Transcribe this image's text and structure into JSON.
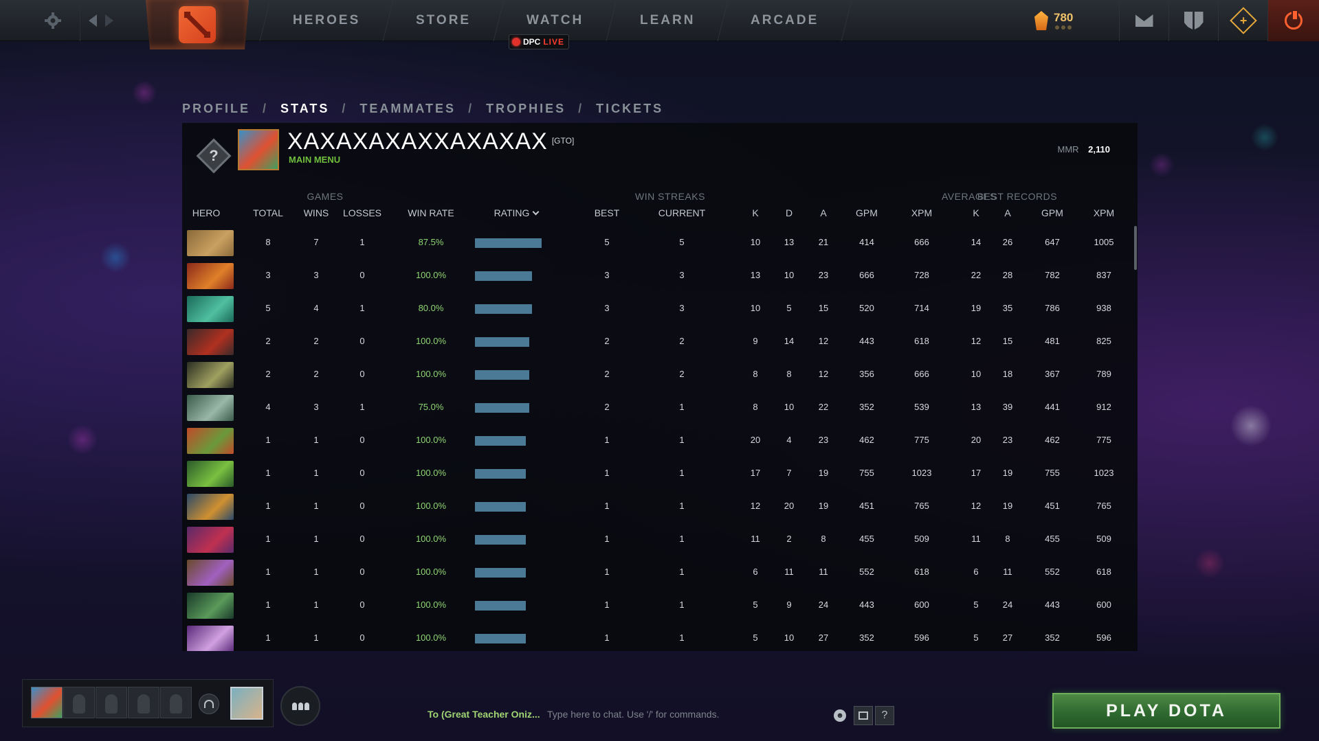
{
  "topbar": {
    "nav": [
      "HEROES",
      "STORE",
      "WATCH",
      "LEARN",
      "ARCADE"
    ],
    "dpc": "DPC",
    "live": "LIVE",
    "shards": "780",
    "icons": [
      "gear-icon",
      "back-arrow-icon",
      "forward-arrow-icon",
      "dota-logo-icon",
      "shards-icon",
      "mail-icon",
      "armory-icon",
      "dota-plus-icon",
      "power-icon"
    ],
    "colors": {
      "accent_orange": "#f06a34",
      "live_red": "#ff3b30",
      "shard_gold": "#f1c36a",
      "power_red": "#ff6030"
    }
  },
  "profile_tabs": [
    "PROFILE",
    "STATS",
    "TEAMMATES",
    "TROPHIES",
    "TICKETS"
  ],
  "profile_tabs_separator": "/",
  "active_tab": "STATS",
  "player": {
    "name": "XAXAXAXAXXAXAXAX",
    "tag": "[GTO]",
    "status": "MAIN MENU",
    "mmr_label": "MMR",
    "mmr_value": "2,110"
  },
  "table": {
    "groups": {
      "games": "GAMES",
      "win_streaks": "WIN STREAKS",
      "averages": "AVERAGES",
      "best_records": "BEST RECORDS"
    },
    "columns": [
      "HERO",
      "TOTAL",
      "WINS",
      "LOSSES",
      "WIN RATE",
      "RATING",
      "BEST",
      "CURRENT",
      "K",
      "D",
      "A",
      "GPM",
      "XPM",
      "K",
      "A",
      "GPM",
      "XPM"
    ],
    "sort_column": "RATING",
    "rating_color": "#4a7a95",
    "win_rate_color": "#8ed672",
    "rows": [
      {
        "hero_icon": "hero-portrait-tan",
        "hero_colors": [
          "#8a6a3a",
          "#c9a060"
        ],
        "total": "8",
        "wins": "7",
        "losses": "1",
        "win_rate": "87.5%",
        "rating": 0.93,
        "best": "5",
        "current": "5",
        "k": "10",
        "d": "13",
        "a": "21",
        "gpm": "414",
        "xpm": "666",
        "best_k": "14",
        "best_a": "26",
        "best_gpm": "647",
        "best_xpm": "1005"
      },
      {
        "hero_icon": "hero-portrait-red",
        "hero_colors": [
          "#8a2a1a",
          "#e0802a"
        ],
        "total": "3",
        "wins": "3",
        "losses": "0",
        "win_rate": "100.0%",
        "rating": 0.8,
        "best": "3",
        "current": "3",
        "k": "13",
        "d": "10",
        "a": "23",
        "gpm": "666",
        "xpm": "728",
        "best_k": "22",
        "best_a": "28",
        "best_gpm": "782",
        "best_xpm": "837"
      },
      {
        "hero_icon": "hero-portrait-teal",
        "hero_colors": [
          "#1a6a5a",
          "#50c0a0"
        ],
        "total": "5",
        "wins": "4",
        "losses": "1",
        "win_rate": "80.0%",
        "rating": 0.8,
        "best": "3",
        "current": "3",
        "k": "10",
        "d": "5",
        "a": "15",
        "gpm": "520",
        "xpm": "714",
        "best_k": "19",
        "best_a": "35",
        "best_gpm": "786",
        "best_xpm": "938"
      },
      {
        "hero_icon": "hero-portrait-dark-red",
        "hero_colors": [
          "#3a2a2a",
          "#b03020"
        ],
        "total": "2",
        "wins": "2",
        "losses": "0",
        "win_rate": "100.0%",
        "rating": 0.76,
        "best": "2",
        "current": "2",
        "k": "9",
        "d": "14",
        "a": "12",
        "gpm": "443",
        "xpm": "618",
        "best_k": "12",
        "best_a": "15",
        "best_gpm": "481",
        "best_xpm": "825"
      },
      {
        "hero_icon": "hero-portrait-olive",
        "hero_colors": [
          "#2a2e22",
          "#a0a060"
        ],
        "total": "2",
        "wins": "2",
        "losses": "0",
        "win_rate": "100.0%",
        "rating": 0.76,
        "best": "2",
        "current": "2",
        "k": "8",
        "d": "8",
        "a": "12",
        "gpm": "356",
        "xpm": "666",
        "best_k": "10",
        "best_a": "18",
        "best_gpm": "367",
        "best_xpm": "789"
      },
      {
        "hero_icon": "hero-portrait-green-gray",
        "hero_colors": [
          "#3a5a4a",
          "#9ab8a8"
        ],
        "total": "4",
        "wins": "3",
        "losses": "1",
        "win_rate": "75.0%",
        "rating": 0.76,
        "best": "2",
        "current": "1",
        "k": "8",
        "d": "10",
        "a": "22",
        "gpm": "352",
        "xpm": "539",
        "best_k": "13",
        "best_a": "39",
        "best_gpm": "441",
        "best_xpm": "912"
      },
      {
        "hero_icon": "hero-portrait-orange-green",
        "hero_colors": [
          "#c04a2a",
          "#6a9a3a"
        ],
        "total": "1",
        "wins": "1",
        "losses": "0",
        "win_rate": "100.0%",
        "rating": 0.71,
        "best": "1",
        "current": "1",
        "k": "20",
        "d": "4",
        "a": "23",
        "gpm": "462",
        "xpm": "775",
        "best_k": "20",
        "best_a": "23",
        "best_gpm": "462",
        "best_xpm": "775"
      },
      {
        "hero_icon": "hero-portrait-green",
        "hero_colors": [
          "#2a5a2a",
          "#7ac040"
        ],
        "total": "1",
        "wins": "1",
        "losses": "0",
        "win_rate": "100.0%",
        "rating": 0.71,
        "best": "1",
        "current": "1",
        "k": "17",
        "d": "7",
        "a": "19",
        "gpm": "755",
        "xpm": "1023",
        "best_k": "17",
        "best_a": "19",
        "best_gpm": "755",
        "best_xpm": "1023"
      },
      {
        "hero_icon": "hero-portrait-gold",
        "hero_colors": [
          "#2a4a6a",
          "#d09030"
        ],
        "total": "1",
        "wins": "1",
        "losses": "0",
        "win_rate": "100.0%",
        "rating": 0.71,
        "best": "1",
        "current": "1",
        "k": "12",
        "d": "20",
        "a": "19",
        "gpm": "451",
        "xpm": "765",
        "best_k": "12",
        "best_a": "19",
        "best_gpm": "451",
        "best_xpm": "765"
      },
      {
        "hero_icon": "hero-portrait-purple-red",
        "hero_colors": [
          "#5a2a6a",
          "#c03050"
        ],
        "total": "1",
        "wins": "1",
        "losses": "0",
        "win_rate": "100.0%",
        "rating": 0.71,
        "best": "1",
        "current": "1",
        "k": "11",
        "d": "2",
        "a": "8",
        "gpm": "455",
        "xpm": "509",
        "best_k": "11",
        "best_a": "8",
        "best_gpm": "455",
        "best_xpm": "509"
      },
      {
        "hero_icon": "hero-portrait-brown-purple",
        "hero_colors": [
          "#6a4a2a",
          "#a060c0"
        ],
        "total": "1",
        "wins": "1",
        "losses": "0",
        "win_rate": "100.0%",
        "rating": 0.71,
        "best": "1",
        "current": "1",
        "k": "6",
        "d": "11",
        "a": "11",
        "gpm": "552",
        "xpm": "618",
        "best_k": "6",
        "best_a": "11",
        "best_gpm": "552",
        "best_xpm": "618"
      },
      {
        "hero_icon": "hero-portrait-green-dark",
        "hero_colors": [
          "#1a3a2a",
          "#5a9a5a"
        ],
        "total": "1",
        "wins": "1",
        "losses": "0",
        "win_rate": "100.0%",
        "rating": 0.71,
        "best": "1",
        "current": "1",
        "k": "5",
        "d": "9",
        "a": "24",
        "gpm": "443",
        "xpm": "600",
        "best_k": "5",
        "best_a": "24",
        "best_gpm": "443",
        "best_xpm": "600"
      },
      {
        "hero_icon": "hero-portrait-violet",
        "hero_colors": [
          "#5a2a7a",
          "#d0a0e0"
        ],
        "total": "1",
        "wins": "1",
        "losses": "0",
        "win_rate": "100.0%",
        "rating": 0.71,
        "best": "1",
        "current": "1",
        "k": "5",
        "d": "10",
        "a": "27",
        "gpm": "352",
        "xpm": "596",
        "best_k": "5",
        "best_a": "27",
        "best_gpm": "352",
        "best_xpm": "596"
      }
    ]
  },
  "chat": {
    "target": "To (Great Teacher Oniz...",
    "placeholder": "Type here to chat. Use '/' for commands.",
    "emoji": "☻",
    "help": "?"
  },
  "play_button": "PLAY DOTA"
}
